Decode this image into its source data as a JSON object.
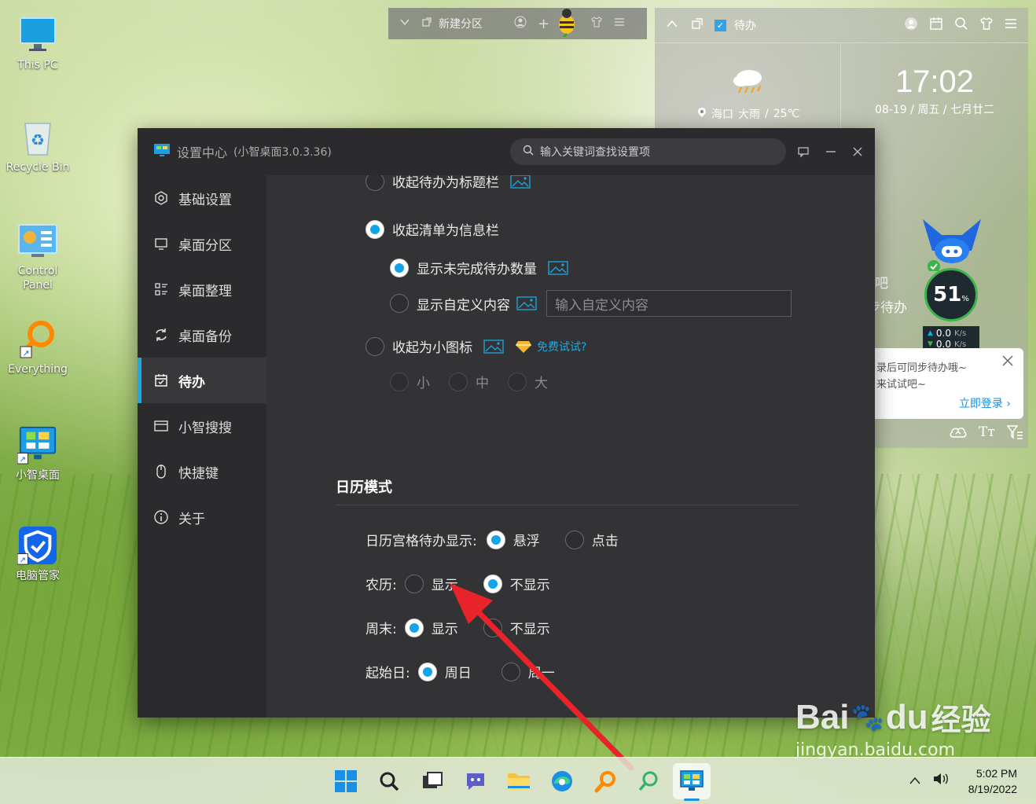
{
  "desktop": {
    "icons": [
      {
        "label": "This PC"
      },
      {
        "label": "Recycle Bin"
      },
      {
        "label": "Control Panel"
      },
      {
        "label": "Everything"
      },
      {
        "label": "小智桌面"
      },
      {
        "label": "电脑管家"
      }
    ]
  },
  "topbar": {
    "new_zone_label": "新建分区"
  },
  "todo_widget": {
    "title": "待办",
    "weather": {
      "location": "海口",
      "condition": "大雨",
      "temp": "25℃"
    },
    "clock": {
      "time": "17:02",
      "date": "08-19 / 周五 / 七月廿二"
    },
    "partial_text_1": "吧",
    "partial_text_2": "步待办",
    "monitor": {
      "percent": "51",
      "unit": "%",
      "up": "0.0",
      "down": "0.0",
      "speed_unit": "K/s"
    },
    "promo": {
      "line1": "录后可同步待办哦~",
      "line2": "来试试吧~",
      "login": "立即登录"
    }
  },
  "settings": {
    "title": "设置中心",
    "version": "(小智桌面3.0.3.36)",
    "search_placeholder": "输入关键词查找设置项",
    "nav": [
      {
        "label": "基础设置",
        "icon": "hexagon-gear-icon",
        "active": false
      },
      {
        "label": "桌面分区",
        "icon": "monitor-icon",
        "active": false
      },
      {
        "label": "桌面整理",
        "icon": "list-grid-icon",
        "active": false
      },
      {
        "label": "桌面备份",
        "icon": "sync-icon",
        "active": false
      },
      {
        "label": "待办",
        "icon": "calendar-check-icon",
        "active": true
      },
      {
        "label": "小智搜搜",
        "icon": "window-icon",
        "active": false
      },
      {
        "label": "快捷键",
        "icon": "mouse-icon",
        "active": false
      },
      {
        "label": "关于",
        "icon": "info-icon",
        "active": false
      }
    ],
    "options": {
      "collapse_title": "收起待办为标题栏",
      "collapse_info": "收起清单为信息栏",
      "show_unfinished": "显示未完成待办数量",
      "show_custom": "显示自定义内容",
      "custom_placeholder": "输入自定义内容",
      "collapse_icon": "收起为小图标",
      "free_trial": "免费试试?",
      "size_small": "小",
      "size_medium": "中",
      "size_large": "大"
    },
    "calendar": {
      "section_title": "日历模式",
      "cell_todo_label": "日历宫格待办显示:",
      "hover": "悬浮",
      "click": "点击",
      "lunar_label": "农历:",
      "show": "显示",
      "hide": "不显示",
      "weekend_label": "周末:",
      "start_label": "起始日:",
      "sunday": "周日",
      "monday": "周一"
    }
  },
  "taskbar": {
    "time": "5:02 PM",
    "date": "8/19/2022"
  },
  "watermark": {
    "brand": "Bai",
    "brand2": "du",
    "brand_cn": "经验",
    "url": "jingyan.baidu.com"
  },
  "colors": {
    "accent": "#11a4e8",
    "settings_bg": "#333336",
    "sidebar_bg": "#2b2b2e",
    "arrow": "#e8232a"
  }
}
